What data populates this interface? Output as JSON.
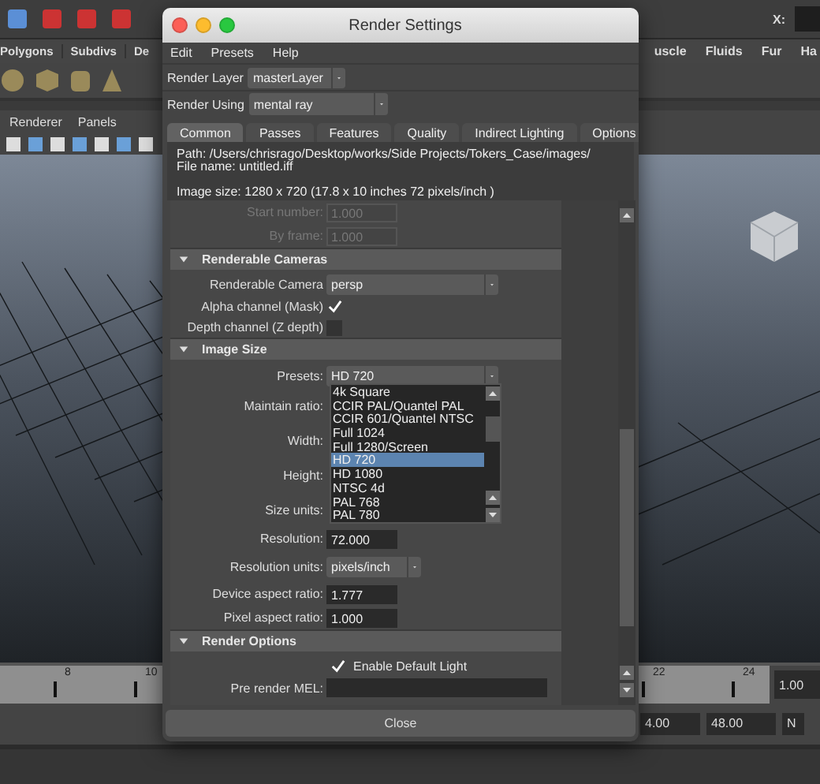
{
  "background": {
    "toolbar_label": "X:",
    "menu_left": [
      "Polygons",
      "Subdivs",
      "De"
    ],
    "menu_right": [
      "uscle",
      "Fluids",
      "Fur",
      "Ha"
    ],
    "panel_menu": [
      "Renderer",
      "Panels"
    ],
    "timeline": {
      "ticks": [
        "8",
        "10",
        "22",
        "24"
      ],
      "current_field": "1.00"
    },
    "range_fields": [
      "4.00",
      "48.00",
      "N"
    ]
  },
  "dialog": {
    "title": "Render Settings",
    "menu": [
      "Edit",
      "Presets",
      "Help"
    ],
    "render_layer": {
      "label": "Render Layer",
      "value": "masterLayer"
    },
    "render_using": {
      "label": "Render Using",
      "value": "mental ray"
    },
    "tabs": [
      {
        "label": "Common",
        "selected": true
      },
      {
        "label": "Passes",
        "selected": false
      },
      {
        "label": "Features",
        "selected": false
      },
      {
        "label": "Quality",
        "selected": false
      },
      {
        "label": "Indirect Lighting",
        "selected": false
      },
      {
        "label": "Options",
        "selected": false
      }
    ],
    "info": {
      "path": "Path: /Users/chrisrago/Desktop/works/Side Projects/Tokers_Case/images/",
      "file_name": "File name:  untitled.iff",
      "image_size": "Image size: 1280 x 720 (17.8 x 10 inches 72 pixels/inch )"
    },
    "rows": [
      {
        "kind": "field",
        "label": "Start number:",
        "value": "1.000",
        "disabled": true
      },
      {
        "kind": "field",
        "label": "By frame:",
        "value": "1.000",
        "disabled": true
      },
      {
        "kind": "section",
        "title": "Renderable Cameras",
        "expanded": true
      },
      {
        "kind": "dropdown",
        "label": "Renderable Camera",
        "value": "persp"
      },
      {
        "kind": "checkbox",
        "label": "Alpha channel (Mask)",
        "checked": true
      },
      {
        "kind": "checkbox",
        "label": "Depth channel (Z depth)",
        "checked": false
      },
      {
        "kind": "section",
        "title": "Image Size",
        "expanded": true
      },
      {
        "kind": "dropdown",
        "label": "Presets:",
        "value": "HD 720",
        "options": [
          {
            "label": "4k Square",
            "selected": false
          },
          {
            "label": "CCIR PAL/Quantel PAL",
            "selected": false
          },
          {
            "label": "CCIR 601/Quantel NTSC",
            "selected": false
          },
          {
            "label": "Full 1024",
            "selected": false
          },
          {
            "label": "Full 1280/Screen",
            "selected": false
          },
          {
            "label": "HD 720",
            "selected": true
          },
          {
            "label": "HD 1080",
            "selected": false
          },
          {
            "label": "NTSC 4d",
            "selected": false
          },
          {
            "label": "PAL 768",
            "selected": false
          },
          {
            "label": "PAL 780",
            "selected": false
          }
        ]
      },
      {
        "kind": "label",
        "label": "Maintain ratio:"
      },
      {
        "kind": "label",
        "label": "Width:"
      },
      {
        "kind": "label",
        "label": "Height:"
      },
      {
        "kind": "label",
        "label": "Size units:"
      },
      {
        "kind": "field",
        "label": "Resolution:",
        "value": "72.000",
        "disabled": false
      },
      {
        "kind": "unit_dropdown",
        "label": "Resolution units:",
        "value": "pixels/inch"
      },
      {
        "kind": "field",
        "label": "Device aspect ratio:",
        "value": "1.777",
        "disabled": false
      },
      {
        "kind": "field",
        "label": "Pixel aspect ratio:",
        "value": "1.000",
        "disabled": false
      },
      {
        "kind": "section",
        "title": "Render Options",
        "expanded": true
      },
      {
        "kind": "check_before",
        "label": "Enable Default Light",
        "checked": true
      },
      {
        "kind": "wide_field",
        "label": "Pre render MEL:"
      }
    ],
    "close_button": "Close"
  }
}
